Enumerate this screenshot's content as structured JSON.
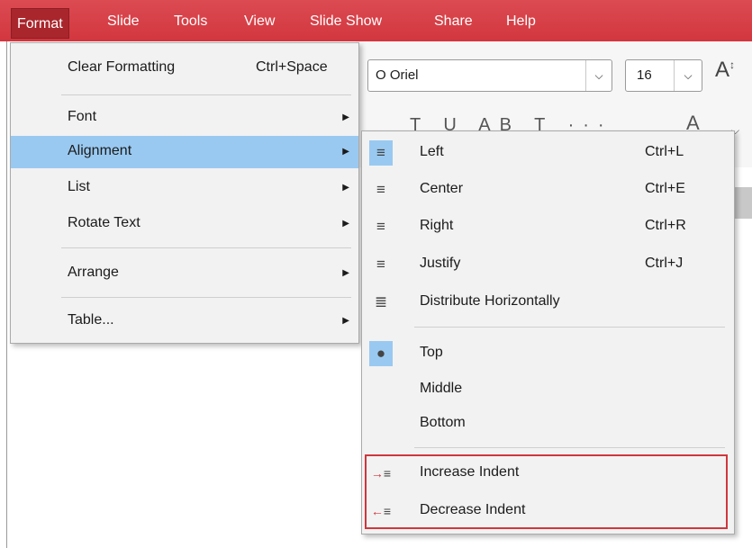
{
  "menubar": {
    "items": [
      "Format",
      "Slide",
      "Tools",
      "View",
      "Slide Show",
      "Share",
      "Help"
    ],
    "active": "Format"
  },
  "toolbar": {
    "font_name": "O Oriel",
    "font_size": "16",
    "format_glyphs": "T U AB T ···",
    "font_color_glyph": "A"
  },
  "format_menu": {
    "items": [
      {
        "label": "Clear Formatting",
        "shortcut": "Ctrl+Space"
      },
      {
        "label": "Font",
        "submenu": true
      },
      {
        "label": "Alignment",
        "submenu": true,
        "highlighted": true
      },
      {
        "label": "List",
        "submenu": true
      },
      {
        "label": "Rotate Text",
        "submenu": true
      },
      {
        "label": "Arrange",
        "submenu": true
      },
      {
        "label": "Table...",
        "submenu": true
      }
    ]
  },
  "alignment_menu": {
    "items": [
      {
        "label": "Left",
        "shortcut": "Ctrl+L",
        "icon": "align-left-icon",
        "selected": true
      },
      {
        "label": "Center",
        "shortcut": "Ctrl+E",
        "icon": "align-center-icon"
      },
      {
        "label": "Right",
        "shortcut": "Ctrl+R",
        "icon": "align-right-icon"
      },
      {
        "label": "Justify",
        "shortcut": "Ctrl+J",
        "icon": "align-justify-icon"
      },
      {
        "label": "Distribute Horizontally",
        "icon": "distribute-horizontally-icon"
      },
      {
        "label": "Top",
        "icon": "bullet-icon",
        "selected": true
      },
      {
        "label": "Middle"
      },
      {
        "label": "Bottom"
      },
      {
        "label": "Increase Indent",
        "icon": "increase-indent-icon"
      },
      {
        "label": "Decrease Indent",
        "icon": "decrease-indent-icon"
      }
    ]
  },
  "colors": {
    "menubar": "#d2363e",
    "highlight": "#99c9f1",
    "callout_border": "#d0363e"
  }
}
